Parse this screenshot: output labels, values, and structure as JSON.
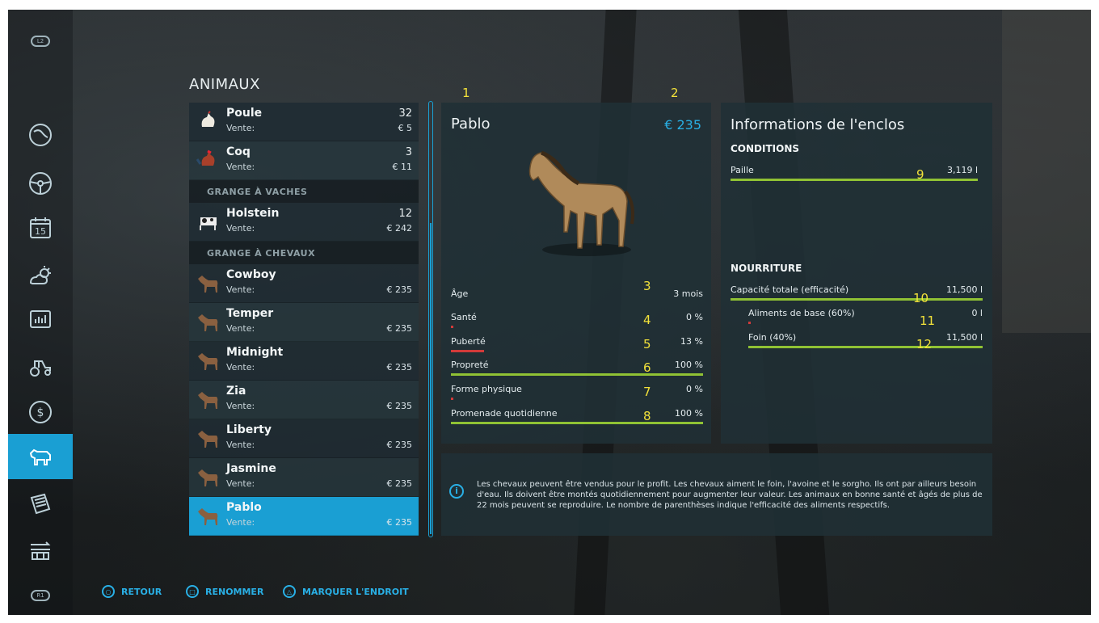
{
  "section_title": "ANIMAUX",
  "list": {
    "items": [
      {
        "type": "animal",
        "name": "Poule",
        "label": "Vente:",
        "count": "32",
        "price": "€ 5",
        "icon": "chicken-icon"
      },
      {
        "type": "animal",
        "name": "Coq",
        "label": "Vente:",
        "count": "3",
        "price": "€ 11",
        "icon": "rooster-icon"
      },
      {
        "type": "group",
        "name": "GRANGE À VACHES"
      },
      {
        "type": "animal",
        "name": "Holstein",
        "label": "Vente:",
        "count": "12",
        "price": "€ 242",
        "icon": "cow-icon"
      },
      {
        "type": "group",
        "name": "GRANGE À CHEVAUX"
      },
      {
        "type": "animal",
        "name": "Cowboy",
        "label": "Vente:",
        "count": "",
        "price": "€ 235",
        "icon": "horse-icon"
      },
      {
        "type": "animal",
        "name": "Temper",
        "label": "Vente:",
        "count": "",
        "price": "€ 235",
        "icon": "horse-icon"
      },
      {
        "type": "animal",
        "name": "Midnight",
        "label": "Vente:",
        "count": "",
        "price": "€ 235",
        "icon": "horse-icon"
      },
      {
        "type": "animal",
        "name": "Zia",
        "label": "Vente:",
        "count": "",
        "price": "€ 235",
        "icon": "horse-icon"
      },
      {
        "type": "animal",
        "name": "Liberty",
        "label": "Vente:",
        "count": "",
        "price": "€ 235",
        "icon": "horse-icon"
      },
      {
        "type": "animal",
        "name": "Jasmine",
        "label": "Vente:",
        "count": "",
        "price": "€ 235",
        "icon": "horse-icon"
      },
      {
        "type": "animal",
        "name": "Pablo",
        "label": "Vente:",
        "count": "",
        "price": "€ 235",
        "icon": "horse-icon",
        "selected": true
      }
    ]
  },
  "annotations": {
    "a1": "1",
    "a2": "2",
    "a3": "3",
    "a4": "4",
    "a5": "5",
    "a6": "6",
    "a7": "7",
    "a8": "8",
    "a9": "9",
    "a10": "10",
    "a11": "11",
    "a12": "12"
  },
  "detail": {
    "name": "Pablo",
    "price": "€ 235",
    "stats": [
      {
        "label": "Âge",
        "value": "3 mois",
        "fill": null
      },
      {
        "label": "Santé",
        "value": "0 %",
        "fill": 0.0,
        "color": "#d23a3a"
      },
      {
        "label": "Puberté",
        "value": "13 %",
        "fill": 0.13,
        "color": "#d23a3a"
      },
      {
        "label": "Propreté",
        "value": "100 %",
        "fill": 1.0,
        "color": "#90c234"
      },
      {
        "label": "Forme physique",
        "value": "0 %",
        "fill": 0.0,
        "color": "#d23a3a"
      },
      {
        "label": "Promenade quotidienne",
        "value": "100 %",
        "fill": 1.0,
        "color": "#90c234"
      }
    ]
  },
  "info": {
    "title": "Informations de l'enclos",
    "conditions_heading": "CONDITIONS",
    "paille_label": "Paille",
    "paille_value": "3,119 l",
    "paille_fill": 1.0,
    "food_heading": "NOURRITURE",
    "food": [
      {
        "label": "Capacité totale (efficacité)",
        "value": "11,500 l",
        "fill": 1.0
      },
      {
        "label": "Aliments de base (60%)",
        "value": "0 l",
        "fill": 0.0
      },
      {
        "label": "Foin (40%)",
        "value": "11,500 l",
        "fill": 1.0
      }
    ]
  },
  "message": {
    "icon": "info-icon",
    "icon_glyph": "i",
    "text": "Les chevaux peuvent être vendus pour le profit. Les chevaux aiment le foin, l'avoine et le sorgho. Ils ont par ailleurs besoin d'eau. Ils doivent être montés quotidiennement pour augmenter leur valeur. Les animaux en bonne santé et âgés de plus de 22 mois peuvent se reproduire. Le nombre de parenthèses indique l'efficacité des aliments respectifs."
  },
  "footer": {
    "back": "RETOUR",
    "rename": "RENOMMER",
    "mark": "MARQUER L'ENDROIT",
    "back_glyph": "○",
    "rename_glyph": "□",
    "mark_glyph": "△"
  },
  "sidebar": {
    "top_pill": "L2",
    "bottom_pill": "R1",
    "icons": [
      "map-icon",
      "steering-wheel-icon",
      "calendar-icon",
      "weather-icon",
      "stats-icon",
      "vehicles-icon",
      "finance-icon",
      "animals-icon",
      "contracts-icon",
      "production-icon"
    ],
    "calendar_day": "15"
  },
  "colors": {
    "accent": "#1a9fd3",
    "bar_good": "#90c234",
    "bar_bad": "#d23a3a",
    "annotation": "#f3e23a"
  }
}
